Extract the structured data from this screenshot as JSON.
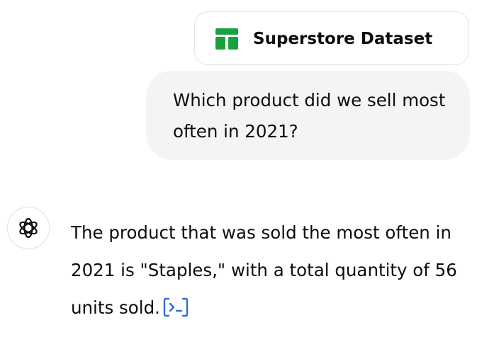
{
  "attachment": {
    "icon": "spreadsheet-icon",
    "name": "Superstore Dataset",
    "icon_color": "#10a37f"
  },
  "user_message": {
    "text": "Which product did we sell most often in 2021?"
  },
  "assistant_message": {
    "avatar_icon": "openai-logo-icon",
    "text": "The product that was sold the most often in 2021 is \"Staples,\" with a total quantity of 56 units sold.",
    "code_link_icon": "view-analysis-icon",
    "link_color": "#2f6bd9"
  }
}
